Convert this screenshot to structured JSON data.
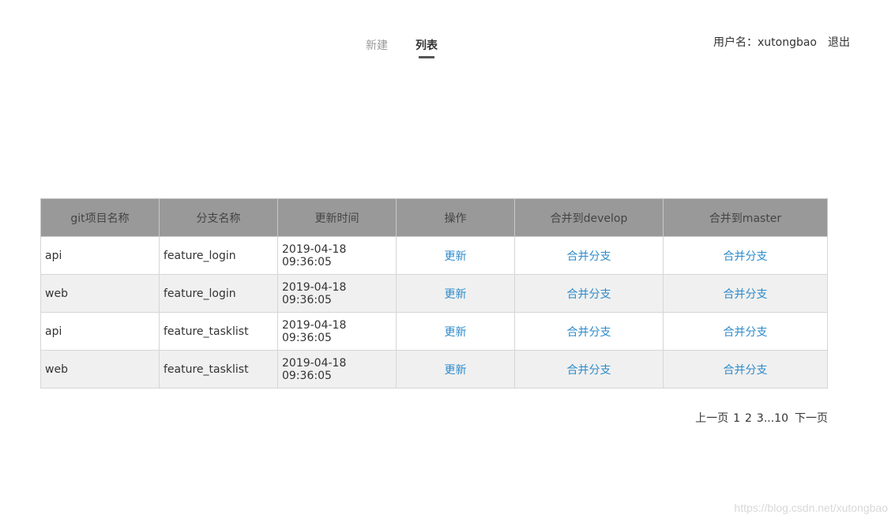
{
  "nav": {
    "tabs": [
      {
        "label": "新建",
        "active": false
      },
      {
        "label": "列表",
        "active": true
      }
    ]
  },
  "user": {
    "label": "用户名：xutongbao",
    "logout": "退出"
  },
  "table": {
    "headers": [
      "git项目名称",
      "分支名称",
      "更新时间",
      "操作",
      "合并到develop",
      "合并到master"
    ],
    "rows": [
      {
        "project": "api",
        "branch": "feature_login",
        "updated": "2019-04-18 09:36:05",
        "action": "更新",
        "merge_develop": "合并分支",
        "merge_master": "合并分支"
      },
      {
        "project": "web",
        "branch": "feature_login",
        "updated": "2019-04-18 09:36:05",
        "action": "更新",
        "merge_develop": "合并分支",
        "merge_master": "合并分支"
      },
      {
        "project": "api",
        "branch": "feature_tasklist",
        "updated": "2019-04-18 09:36:05",
        "action": "更新",
        "merge_develop": "合并分支",
        "merge_master": "合并分支"
      },
      {
        "project": "web",
        "branch": "feature_tasklist",
        "updated": "2019-04-18 09:36:05",
        "action": "更新",
        "merge_develop": "合并分支",
        "merge_master": "合并分支"
      }
    ]
  },
  "pager": {
    "prev": "上一页",
    "pages": [
      "1",
      "2",
      "3...10"
    ],
    "next": "下一页"
  },
  "watermark": "https://blog.csdn.net/xutongbao",
  "colors": {
    "header_bg": "#999999",
    "link": "#2e8bc9",
    "stripe": "#f0f0f0"
  }
}
